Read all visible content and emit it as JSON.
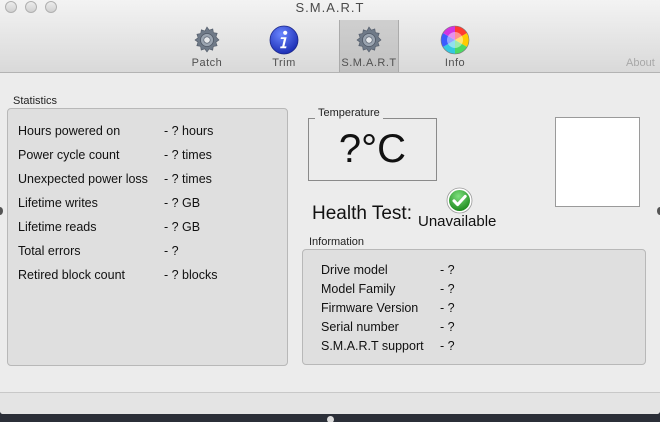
{
  "window": {
    "title": "S.M.A.R.T"
  },
  "toolbar": {
    "items": [
      {
        "label": "Patch",
        "icon": "gear-icon"
      },
      {
        "label": "Trim",
        "icon": "info-icon"
      },
      {
        "label": "S.M.A.R.T",
        "icon": "gear-icon",
        "selected": true
      },
      {
        "label": "Info",
        "icon": "color-wheel-icon"
      }
    ],
    "about_label": "About"
  },
  "statistics": {
    "title": "Statistics",
    "rows": [
      {
        "label": "Hours powered on",
        "value": "- ? hours"
      },
      {
        "label": "Power cycle count",
        "value": "- ? times"
      },
      {
        "label": "Unexpected power loss",
        "value": "- ? times"
      },
      {
        "label": "Lifetime writes",
        "value": "- ? GB"
      },
      {
        "label": "Lifetime reads",
        "value": "- ? GB"
      },
      {
        "label": "Total errors",
        "value": "- ?"
      },
      {
        "label": "Retired block count",
        "value": "- ? blocks"
      }
    ]
  },
  "temperature": {
    "title": "Temperature",
    "value": "?°C"
  },
  "health": {
    "label": "Health Test:",
    "value": "Unavailable",
    "status_color": "#2e9a2e"
  },
  "information": {
    "title": "Information",
    "rows": [
      {
        "label": "Drive model",
        "value": "- ?"
      },
      {
        "label": "Model Family",
        "value": "- ?"
      },
      {
        "label": "Firmware Version",
        "value": "- ?"
      },
      {
        "label": "Serial number",
        "value": "- ?"
      },
      {
        "label": "S.M.A.R.T support",
        "value": "- ?"
      }
    ]
  }
}
